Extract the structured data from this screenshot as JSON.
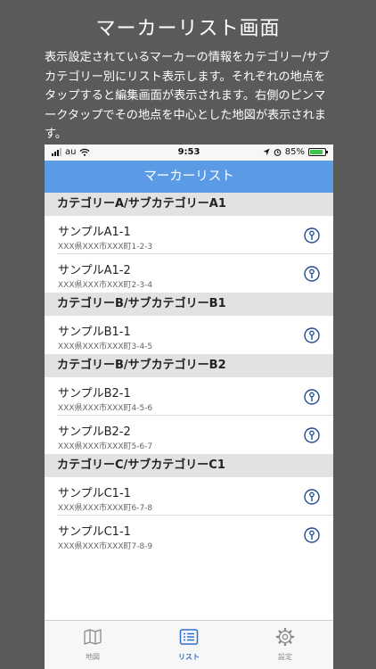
{
  "promo": {
    "title": "マーカーリスト画面",
    "description": "表示設定されているマーカーの情報をカテゴリー/サブカテゴリー別にリスト表示します。それぞれの地点をタップすると編集画面が表示されます。右側のピンマークタップでその地点を中心とした地図が表示されます。"
  },
  "status_bar": {
    "carrier": "au",
    "time": "9:53",
    "battery": "85%",
    "battery_level": 0.85
  },
  "nav": {
    "title": "マーカーリスト"
  },
  "sections": [
    {
      "header": "カテゴリーA/サブカテゴリーA1",
      "items": [
        {
          "title": "サンプルA1-1",
          "address": "XXX県XXX市XXX町1-2-3"
        },
        {
          "title": "サンプルA1-2",
          "address": "XXX県XXX市XXX町2-3-4"
        }
      ]
    },
    {
      "header": "カテゴリーB/サブカテゴリーB1",
      "items": [
        {
          "title": "サンプルB1-1",
          "address": "XXX県XXX市XXX町3-4-5"
        }
      ]
    },
    {
      "header": "カテゴリーB/サブカテゴリーB2",
      "items": [
        {
          "title": "サンプルB2-1",
          "address": "XXX県XXX市XXX町4-5-6"
        },
        {
          "title": "サンプルB2-2",
          "address": "XXX県XXX市XXX町5-6-7"
        }
      ]
    },
    {
      "header": "カテゴリーC/サブカテゴリーC1",
      "items": [
        {
          "title": "サンプルC1-1",
          "address": "XXX県XXX市XXX町6-7-8"
        },
        {
          "title": "サンプルC1-1",
          "address": "XXX県XXX市XXX町7-8-9"
        }
      ]
    }
  ],
  "tabs": [
    {
      "label": "地図",
      "icon": "map-icon",
      "active": false
    },
    {
      "label": "リスト",
      "icon": "list-icon",
      "active": true
    },
    {
      "label": "設定",
      "icon": "gear-icon",
      "active": false
    }
  ],
  "colors": {
    "background": "#5a5a5a",
    "nav_bar": "#5b9be6",
    "section_header": "#e2e2e2",
    "accent": "#2f6fd6",
    "pin_icon": "#1f4f8f"
  }
}
